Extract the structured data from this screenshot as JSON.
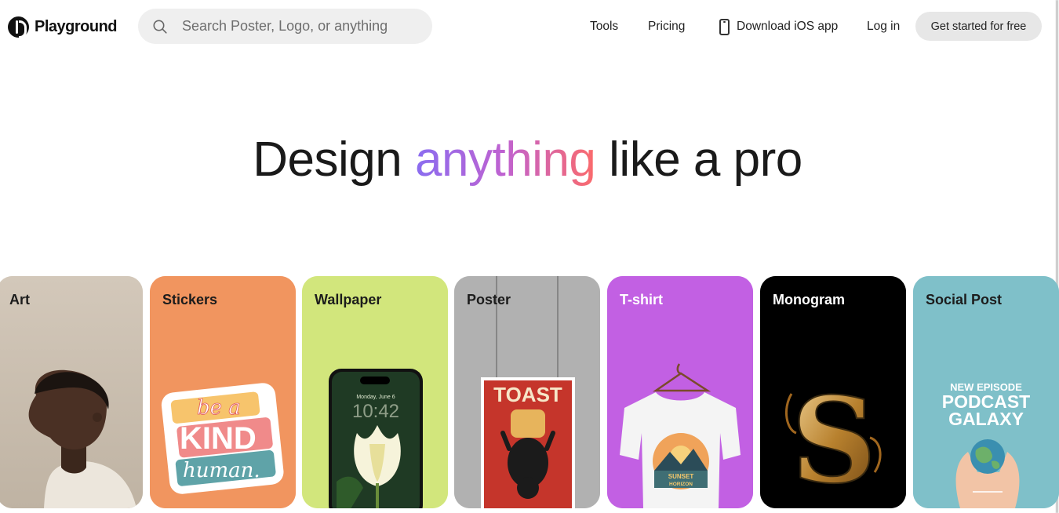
{
  "header": {
    "brand": "Playground",
    "search_placeholder": "Search Poster, Logo, or anything",
    "nav": {
      "tools": "Tools",
      "pricing": "Pricing",
      "ios": "Download iOS app",
      "login": "Log in"
    },
    "cta": "Get started for free"
  },
  "hero": {
    "pre": "Design",
    "accent": "anything",
    "post": "like a pro",
    "accent_colors": [
      "#8a6df0",
      "#c062d0",
      "#fb6b6b"
    ]
  },
  "categories": [
    {
      "label": "Art",
      "bg": "#cfc3b5"
    },
    {
      "label": "Stickers",
      "bg": "#f1955f"
    },
    {
      "label": "Wallpaper",
      "bg": "#d2e67c"
    },
    {
      "label": "Poster",
      "bg": "#b1b1b1"
    },
    {
      "label": "T-shirt",
      "bg": "#c260e3"
    },
    {
      "label": "Monogram",
      "bg": "#000000"
    },
    {
      "label": "Social Post",
      "bg": "#7fc0c9"
    }
  ],
  "artwork_text": {
    "sticker_line1": "be a",
    "sticker_line2": "KIND",
    "sticker_line3": "human.",
    "wallpaper_date": "Monday, June 6",
    "wallpaper_time": "10:42",
    "poster_title": "TOAST",
    "tshirt_line1": "SUNSET",
    "tshirt_line2": "HORIZON",
    "monogram_letter": "S",
    "social_line1": "NEW EPISODE",
    "social_line2": "PODCAST",
    "social_line3": "GALAXY"
  }
}
